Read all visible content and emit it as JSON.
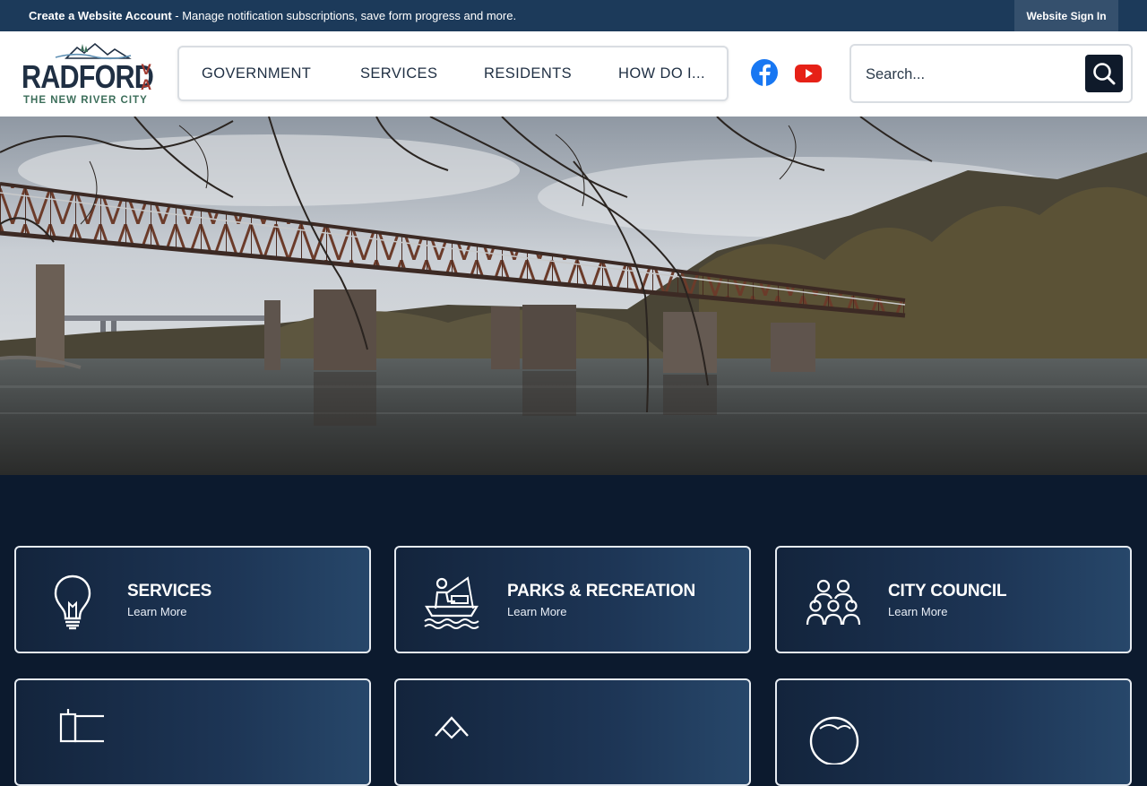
{
  "topbar": {
    "create_account": "Create a Website Account",
    "message": " - Manage notification subscriptions, save form progress and more.",
    "signin": "Website Sign In"
  },
  "logo": {
    "name": "RADFORD",
    "state_v": "V",
    "state_a": "A",
    "tagline": "THE NEW RIVER CITY"
  },
  "nav": {
    "items": [
      "GOVERNMENT",
      "SERVICES",
      "RESIDENTS",
      "HOW DO I..."
    ]
  },
  "social": {
    "facebook_icon": "facebook-icon",
    "youtube_icon": "youtube-icon",
    "facebook_color": "#1877f2",
    "youtube_color": "#e62117"
  },
  "search": {
    "placeholder": "Search..."
  },
  "cards": [
    {
      "title": "SERVICES",
      "sub": "Learn More",
      "icon": "lightbulb-icon"
    },
    {
      "title": "PARKS & RECREATION",
      "sub": "Learn More",
      "icon": "fishing-boat-icon"
    },
    {
      "title": "CITY COUNCIL",
      "sub": "Learn More",
      "icon": "people-group-icon"
    },
    {
      "title": "",
      "sub": "",
      "icon": "building-icon"
    },
    {
      "title": "",
      "sub": "",
      "icon": "house-icon"
    },
    {
      "title": "",
      "sub": "",
      "icon": "globe-icon"
    }
  ],
  "colors": {
    "topbar": "#1c3a5a",
    "navy": "#0c1a2e",
    "logo_text": "#1f2f43",
    "logo_accent": "#a33a30",
    "logo_tag": "#3c6e5a"
  }
}
